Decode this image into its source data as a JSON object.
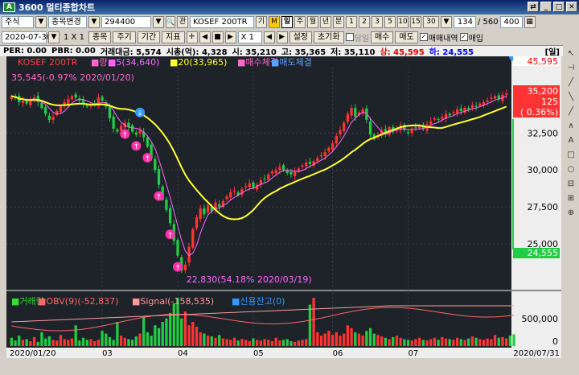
{
  "window": {
    "badge": "A",
    "title": "3600 멀티종합차트",
    "btns": [
      "⇄",
      "_",
      "□",
      "✕"
    ]
  },
  "toolbar1": {
    "mode_select": "주식",
    "mode_arrow": "▼",
    "search_label": "종목변경",
    "search_arrow": "▼",
    "code": "294400",
    "code_arrow": "▼",
    "mag_icon": "🔍",
    "mag_label": "관",
    "name": "KOSEF 200TR",
    "name_flag": "기",
    "name_flag2": "M",
    "periods": [
      "일",
      "주",
      "월",
      "년",
      "분"
    ],
    "num_buttons": [
      "1",
      "2",
      "3",
      "5",
      "10",
      "15",
      "30"
    ],
    "num_dropdown": "▼",
    "count_value": "134",
    "count_total": "/ 560",
    "zoom_value": "400",
    "grid_icon": "▦"
  },
  "toolbar2": {
    "date": "2020-07-30",
    "date_arrow": "▼",
    "ratio": "1 X 1",
    "btn_items": "종목",
    "btn_period": "주기",
    "btn_range": "기간",
    "btn_indicator": "지표",
    "zoom_label": "X 1",
    "btn_settings": "설정",
    "btn_reset": "초기화",
    "chk_today": "당일",
    "btn_buy": "매수",
    "btn_sell": "매도",
    "chk_trades": "매매내역",
    "chk_orders": "매입",
    "nav_prev": "◀",
    "nav_stop": "■",
    "nav_next": "▶",
    "nav_prev2": "◀",
    "nav_next2": "▶"
  },
  "infobar": {
    "per": "PER: 0.00",
    "pbr": "PBR: 0.00",
    "volume": "거래대금: 5,574",
    "mcap": "시총(억): 4,328",
    "open": "시: 35,210",
    "high": "고: 35,365",
    "low": "저: 35,110",
    "upper": "상: 45,595",
    "lower": "하: 24,555",
    "tag": "[일]"
  },
  "chart_data": [
    {
      "type": "candlestick",
      "name": "KOSEF 200TR",
      "legend": [
        "KOSEF 200TR",
        "량",
        "5(34,640)",
        "20(33,965)",
        "매수체결",
        "매도체결"
      ],
      "legend_colors": [
        "#ff4040",
        "#ff66cc",
        "#ff66ff",
        "#ffff33",
        "#ff66cc",
        "#5aa0ff"
      ],
      "annotations": {
        "high_note": "35,545(-0.97% 2020/01/20)",
        "low_note": "22,830(54.18% 2020/03/19)",
        "current_price": "35,200",
        "current_change": "125",
        "current_pct": "( 0.36%)",
        "upper_limit": "45,595",
        "lower_limit": "24,555"
      },
      "y_ticks": [
        25000,
        27500,
        30000,
        32500
      ],
      "y_tick_labels": [
        "25,000",
        "27,500",
        "30,000",
        "32,500"
      ],
      "ylim": [
        22000,
        36500
      ],
      "x_labels": [
        "2020/01/20",
        "03",
        "04",
        "05",
        "06",
        "07",
        "2020/07/31"
      ],
      "close": [
        35000,
        34900,
        34600,
        34700,
        34500,
        34800,
        34900,
        34600,
        34200,
        33800,
        33400,
        33600,
        34000,
        34300,
        34600,
        34800,
        35000,
        34900,
        34700,
        34500,
        34300,
        34400,
        34500,
        34900,
        34700,
        34300,
        33500,
        32800,
        32600,
        33000,
        33200,
        32900,
        32600,
        32400,
        32700,
        32200,
        31600,
        30800,
        30000,
        29000,
        28000,
        27300,
        26400,
        25200,
        24200,
        23200,
        23600,
        24800,
        26000,
        26800,
        27400,
        27000,
        27600,
        27200,
        27800,
        27500,
        27900,
        28200,
        28500,
        28600,
        28300,
        28700,
        28900,
        29100,
        28800,
        29000,
        29300,
        29400,
        29700,
        29900,
        30000,
        30200,
        30000,
        29800,
        29700,
        29900,
        30100,
        30300,
        30500,
        30400,
        30600,
        30800,
        31000,
        31200,
        31500,
        31800,
        32300,
        32700,
        33200,
        33800,
        34200,
        33600,
        33900,
        34100,
        33400,
        32400,
        32100,
        32400,
        32700,
        32500,
        32900,
        32600,
        32800,
        33000,
        32700,
        32500,
        32800,
        32900,
        33000,
        32800,
        33100,
        33300,
        33500,
        33400,
        33600,
        33800,
        33700,
        33900,
        34100,
        34000,
        34200,
        34100,
        34400,
        34300,
        34500,
        34600,
        34700,
        34900,
        35000,
        34800,
        35100,
        35200
      ],
      "volume": [
        120,
        80,
        150,
        90,
        100,
        70,
        130,
        60,
        200,
        110,
        140,
        90,
        80,
        160,
        100,
        90,
        110,
        300,
        80,
        120,
        90,
        100,
        70,
        90,
        220,
        180,
        130,
        90,
        350,
        150,
        120,
        100,
        90,
        140,
        180,
        420,
        200,
        150,
        300,
        260,
        350,
        400,
        480,
        620,
        700,
        400,
        500,
        300,
        350,
        280,
        200,
        180,
        150,
        140,
        120,
        160,
        110,
        100,
        90,
        120,
        80,
        100,
        90,
        70,
        110,
        90,
        80,
        100,
        90,
        70,
        120,
        80,
        90,
        100,
        70,
        60,
        80,
        90,
        100,
        600,
        700,
        200,
        150,
        180,
        220,
        160,
        200,
        150,
        180,
        300,
        260,
        200,
        180,
        150,
        220,
        260,
        180,
        160,
        140,
        120,
        100,
        130,
        150,
        120,
        100,
        90,
        80,
        100,
        120,
        90,
        80,
        100,
        120,
        90,
        130,
        110,
        100,
        90,
        120,
        100,
        90,
        110,
        140,
        120,
        100,
        90,
        110,
        100,
        160,
        120,
        130,
        110,
        150,
        170
      ],
      "volume_legend": [
        "거래량",
        "OBV(9)(-52,837)",
        "Signal(-158,535)",
        "신용잔고(0)"
      ],
      "volume_legend_colors": [
        "#33dd33",
        "#ff6666",
        "#ff9999",
        "#3399ff"
      ],
      "volume_ticks": [
        "500,000",
        "0"
      ]
    }
  ],
  "right_tools": [
    "↖",
    "⊣",
    "╱",
    "╲",
    "╱",
    "∧",
    "A",
    "□",
    "○",
    "⊟",
    "⊞",
    "⊕"
  ]
}
